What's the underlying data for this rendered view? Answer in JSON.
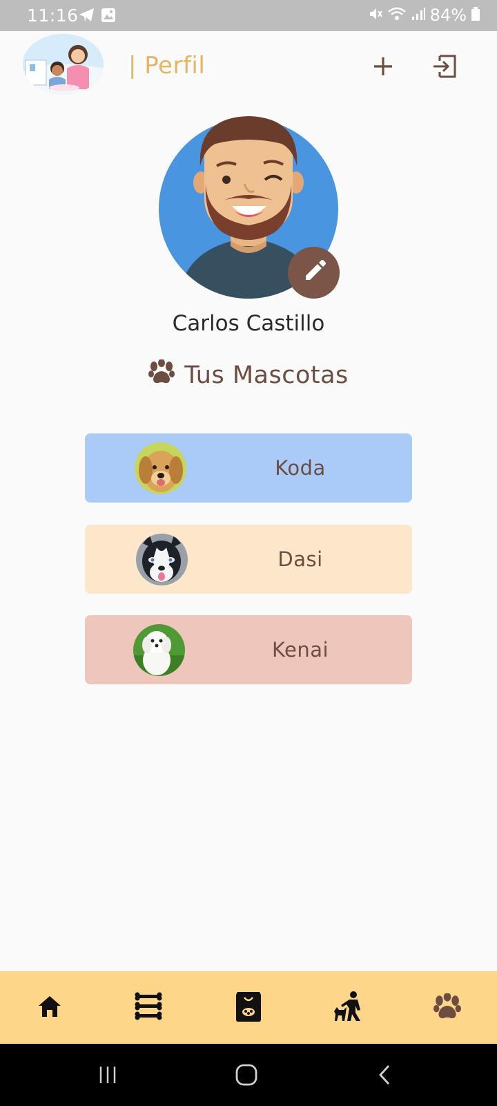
{
  "status_bar": {
    "time": "11:16",
    "battery": "84%",
    "icons": [
      "telegram-icon",
      "gallery-icon",
      "mute-icon",
      "wifi-icon",
      "signal-icon",
      "battery-icon"
    ]
  },
  "header": {
    "title": "| Perfil",
    "logo_icon": "clinic-logo",
    "add_icon": "plus-icon",
    "logout_icon": "logout-icon"
  },
  "profile": {
    "name": "Carlos Castillo",
    "avatar_icon": "user-avatar",
    "edit_icon": "pencil-icon"
  },
  "pets_section": {
    "heading": "Tus Mascotas",
    "heading_icon": "paw-icon"
  },
  "pets": [
    {
      "name": "Koda",
      "color": "#aacbf7",
      "breed_photo": "golden-retriever-photo"
    },
    {
      "name": "Dasi",
      "color": "#fde7ca",
      "breed_photo": "husky-photo"
    },
    {
      "name": "Kenai",
      "color": "#efc6bb",
      "breed_photo": "maltese-photo"
    }
  ],
  "bottom_nav": {
    "items": [
      {
        "icon": "home-icon"
      },
      {
        "icon": "bones-icon"
      },
      {
        "icon": "food-bag-icon"
      },
      {
        "icon": "training-icon"
      },
      {
        "icon": "paw-icon",
        "active": true
      }
    ]
  },
  "colors": {
    "brand_brown": "#7a5548",
    "header_title": "#e6b563",
    "nav_bg": "#fdd68a"
  }
}
